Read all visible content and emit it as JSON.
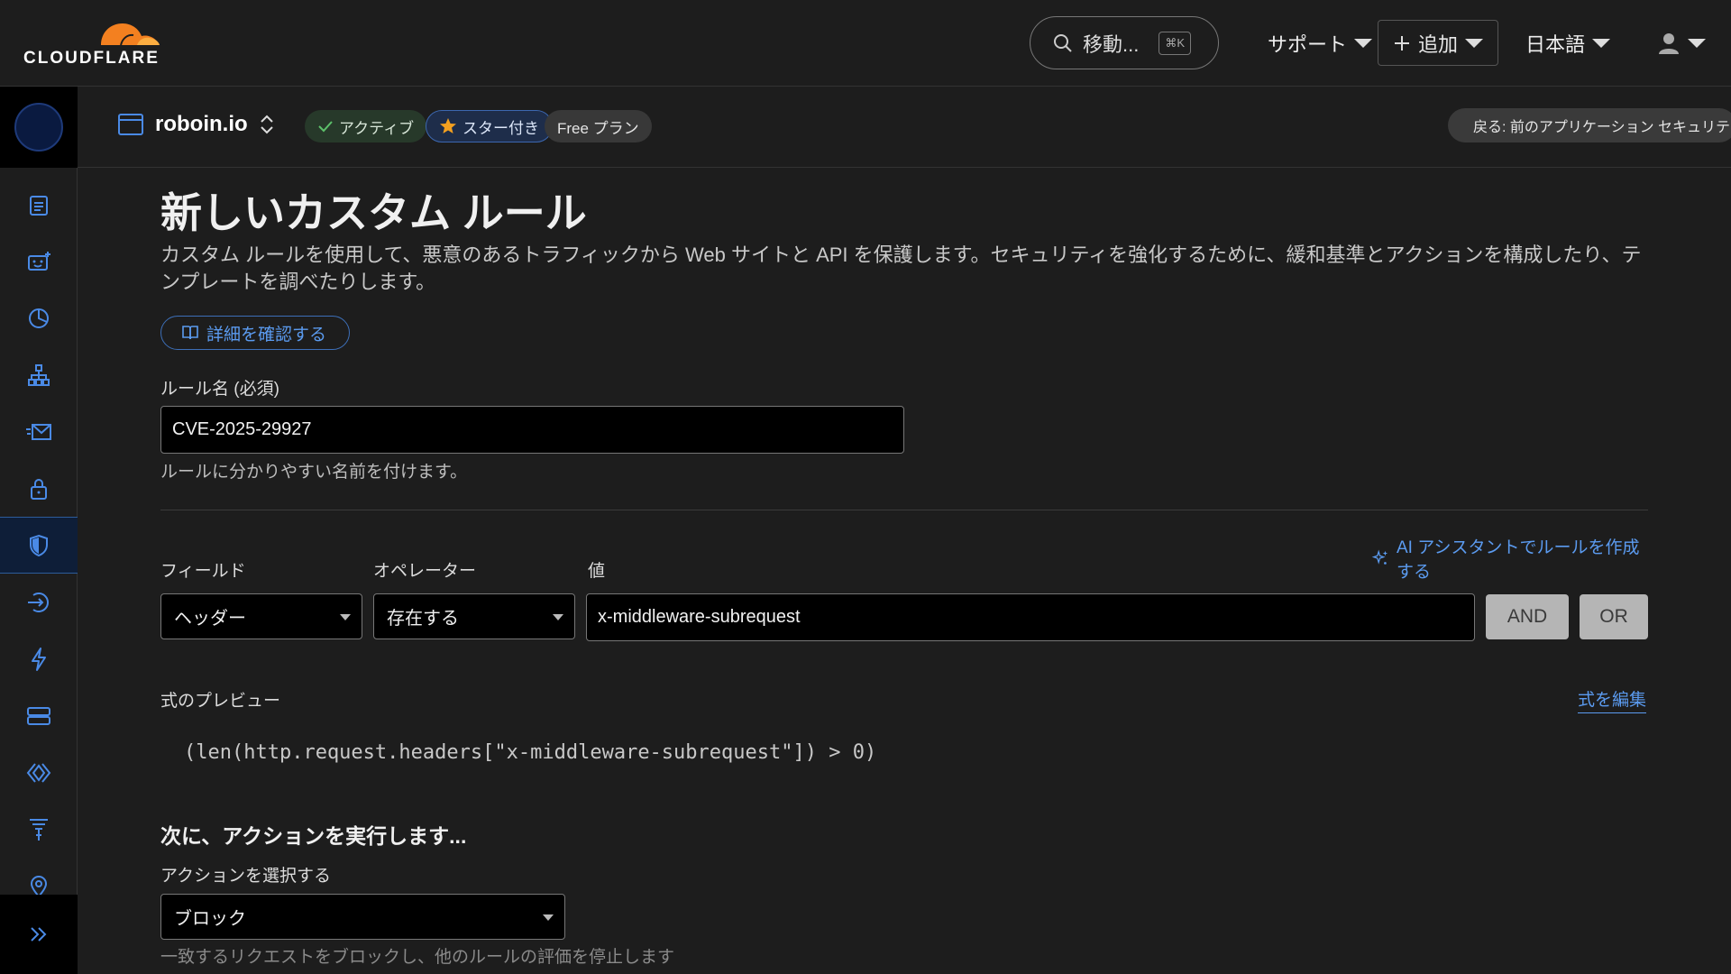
{
  "brand": {
    "name": "CLOUDFLARE",
    "accent": "#f38020"
  },
  "topbar": {
    "search_label": "移動...",
    "search_shortcut": "⌘K",
    "support_label": "サポート",
    "add_label": "追加",
    "language_label": "日本語"
  },
  "subheader": {
    "domain": "roboin.io",
    "status_label": "アクティブ",
    "starred_label": "スター付き",
    "plan_label": "Free プラン",
    "back_label": "戻る: 前のアプリケーション セキュリティ"
  },
  "sidebar": {
    "icons": [
      "clipboard-icon",
      "robot-icon",
      "pie-chart-icon",
      "network-icon",
      "email-icon",
      "lock-icon",
      "shield-icon",
      "routing-icon",
      "lightning-icon",
      "storage-icon",
      "code-icon",
      "filter-icon",
      "location-icon"
    ],
    "active_index": 6,
    "expand_icon": "double-chevron-right-icon"
  },
  "page": {
    "title": "新しいカスタム ルール",
    "description": "カスタム ルールを使用して、悪意のあるトラフィックから Web サイトと API を保護します。セキュリティを強化するために、緩和基準とアクションを構成したり、テンプレートを調べたりします。",
    "learn_more": "詳細を確認する"
  },
  "rule_name": {
    "label": "ルール名 (必須)",
    "value": "CVE-2025-29927",
    "hint": "ルールに分かりやすい名前を付けます。"
  },
  "ai_assistant_label": "AI アシスタントでルールを作成する",
  "expression_builder": {
    "field_label": "フィールド",
    "field_value": "ヘッダー",
    "operator_label": "オペレーター",
    "operator_value": "存在する",
    "value_label": "値",
    "value_value": "x-middleware-subrequest",
    "and_label": "AND",
    "or_label": "OR"
  },
  "preview": {
    "label": "式のプレビュー",
    "edit_label": "式を編集",
    "expression": "(len(http.request.headers[\"x-middleware-subrequest\"]) > 0)"
  },
  "action": {
    "section_title": "次に、アクションを実行します...",
    "label": "アクションを選択する",
    "value": "ブロック",
    "hint": "一致するリクエストをブロックし、他のルールの評価を停止します"
  }
}
